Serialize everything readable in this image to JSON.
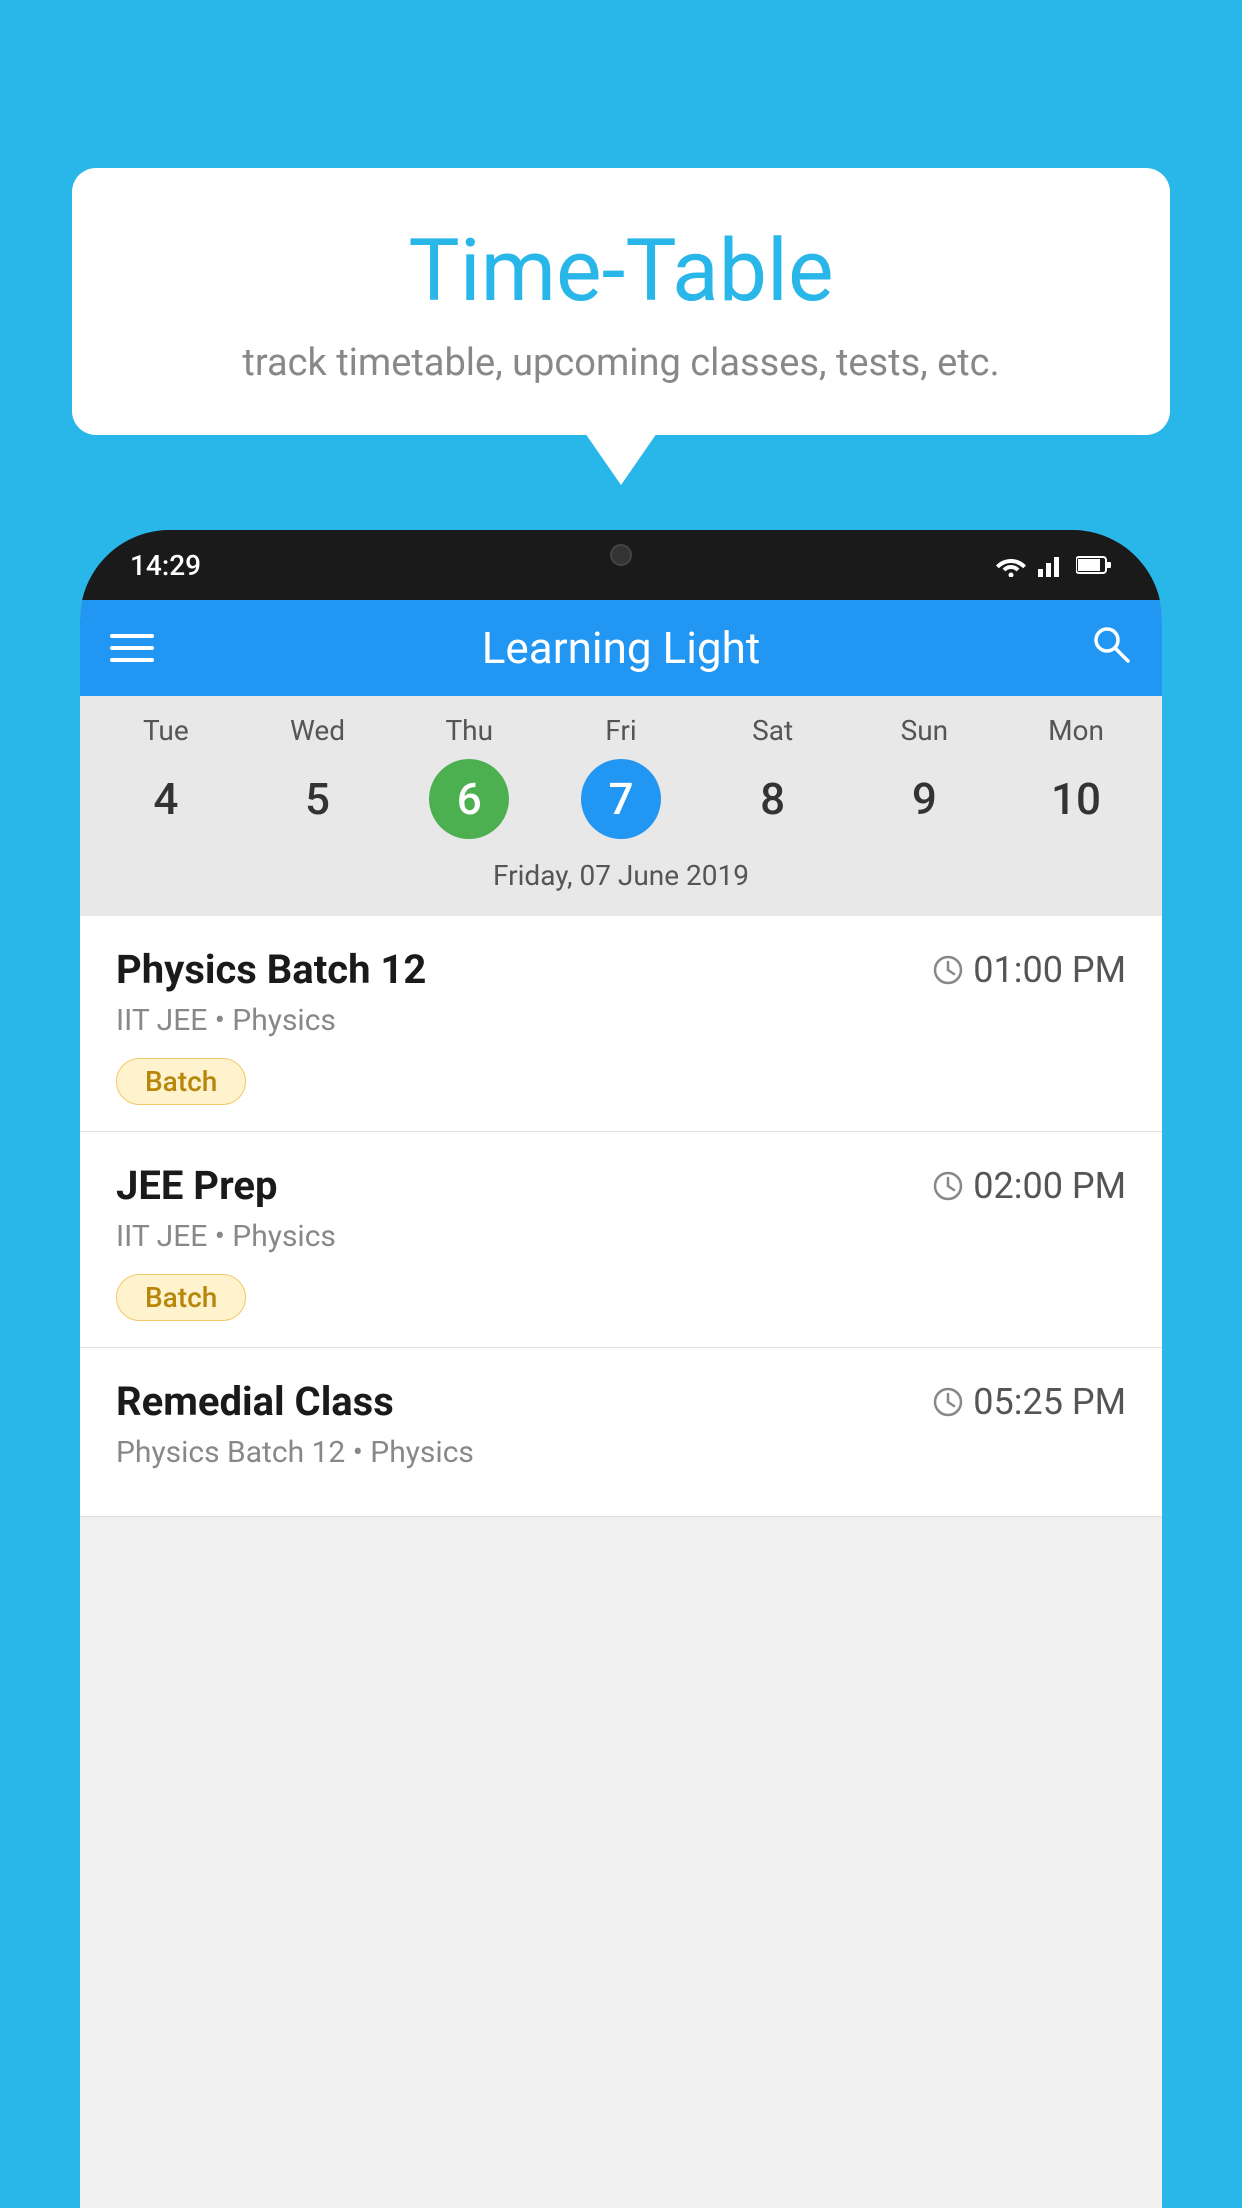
{
  "background_color": "#29B6E8",
  "speech_bubble": {
    "title": "Time-Table",
    "subtitle": "track timetable, upcoming classes, tests, etc."
  },
  "phone": {
    "status_bar": {
      "time": "14:29"
    },
    "app_bar": {
      "title": "Learning Light",
      "menu_icon": "hamburger-icon",
      "search_icon": "search-icon"
    },
    "calendar": {
      "days": [
        {
          "name": "Tue",
          "num": "4",
          "state": "normal"
        },
        {
          "name": "Wed",
          "num": "5",
          "state": "normal"
        },
        {
          "name": "Thu",
          "num": "6",
          "state": "today"
        },
        {
          "name": "Fri",
          "num": "7",
          "state": "selected"
        },
        {
          "name": "Sat",
          "num": "8",
          "state": "normal"
        },
        {
          "name": "Sun",
          "num": "9",
          "state": "normal"
        },
        {
          "name": "Mon",
          "num": "10",
          "state": "normal"
        }
      ],
      "selected_date_label": "Friday, 07 June 2019"
    },
    "classes": [
      {
        "name": "Physics Batch 12",
        "time": "01:00 PM",
        "subject": "IIT JEE • Physics",
        "badge": "Batch"
      },
      {
        "name": "JEE Prep",
        "time": "02:00 PM",
        "subject": "IIT JEE • Physics",
        "badge": "Batch"
      },
      {
        "name": "Remedial Class",
        "time": "05:25 PM",
        "subject": "Physics Batch 12 • Physics",
        "badge": null
      }
    ]
  }
}
